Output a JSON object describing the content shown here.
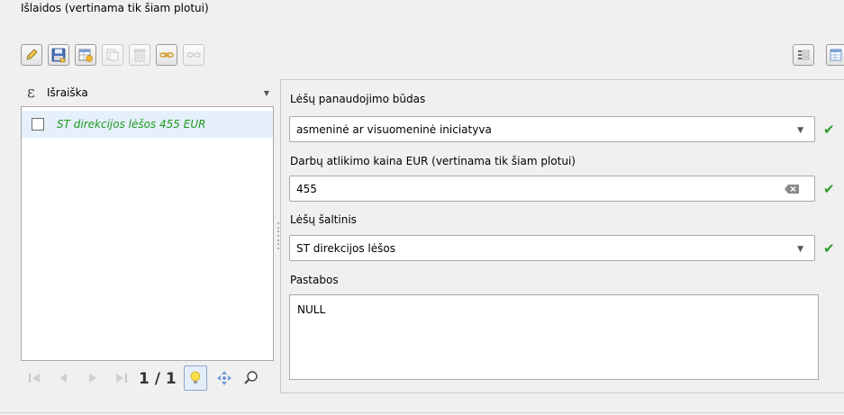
{
  "header": {
    "title": "Išlaidos (vertinama tik šiam plotui)"
  },
  "toolbar": {
    "buttons": [
      {
        "name": "toggle-editing-button",
        "icon": "pencil-icon",
        "enabled": true
      },
      {
        "name": "save-edits-button",
        "icon": "save-icon",
        "enabled": true
      },
      {
        "name": "add-feature-button",
        "icon": "add-feature-icon",
        "enabled": true
      },
      {
        "name": "duplicate-feature-button",
        "icon": "duplicate-icon",
        "enabled": false
      },
      {
        "name": "delete-feature-button",
        "icon": "trash-icon",
        "enabled": false
      },
      {
        "name": "link-feature-button",
        "icon": "link-icon",
        "enabled": true
      },
      {
        "name": "unlink-feature-button",
        "icon": "unlink-icon",
        "enabled": false
      }
    ],
    "right_buttons": [
      {
        "name": "form-view-button",
        "icon": "form-view-icon"
      },
      {
        "name": "table-view-button",
        "icon": "table-view-icon"
      }
    ]
  },
  "list": {
    "expression_icon": "ε",
    "expression_label": "Išraiška",
    "items": [
      {
        "label": "ST direkcijos lėšos 455 EUR",
        "checked": false,
        "color": "#1d9b1d"
      }
    ]
  },
  "navigation": {
    "page_text": "1 / 1"
  },
  "form": {
    "fields": [
      {
        "label": "Lėšų panaudojimo būdas",
        "value": "asmeninė ar visuomeninė iniciatyva",
        "type": "dropdown"
      },
      {
        "label": "Darbų atlikimo kaina EUR (vertinama tik šiam plotui)",
        "value": "455",
        "type": "text"
      },
      {
        "label": "Lėšų šaltinis",
        "value": "ST direkcijos lėšos",
        "type": "dropdown"
      },
      {
        "label": "Pastabos",
        "value": "NULL",
        "type": "textarea"
      }
    ],
    "check_glyph": "✔"
  },
  "colors": {
    "valid": "#2e9a2e",
    "selected_row": "#e5f0fb",
    "feature_text": "#1d9b1d"
  }
}
